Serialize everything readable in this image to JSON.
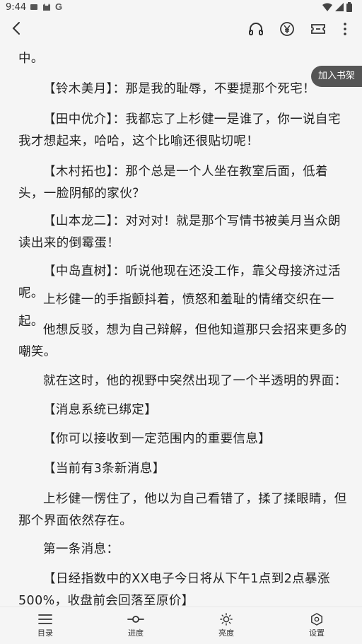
{
  "status_bar": {
    "time": "9:44"
  },
  "book": {
    "add_to_shelf": "加入书架"
  },
  "paragraphs": [
    "中。",
    "【铃木美月】：那是我的耻辱，不要提那个死宅！",
    "【田中优介】：我都忘了上杉健一是谁了，你一说自宅我才想起来，哈哈，这个比喻还很贴切呢！",
    "【木村拓也】：那个总是一个人坐在教室后面，低着头，一脸阴郁的家伙？",
    "【山本龙二】：对对对！就是那个写情书被美月当众朗读出来的倒霉蛋！",
    "【中岛直树】：听说他现在还没工作，靠父母接济过活呢。",
    "上杉健一的手指颤抖着，愤怒和羞耻的情绪交织在一起。",
    "他想反驳，想为自己辩解，但他知道那只会招来更多的嘲笑。",
    "就在这时，他的视野中突然出现了一个半透明的界面：",
    "【消息系统已绑定】",
    "【你可以接收到一定范围内的重要信息】",
    "【当前有3条新消息】",
    "上杉健一愣住了，他以为自己看错了，揉了揉眼睛，但那个界面依然存在。",
    "第一条消息：",
    "【日经指数中的XX电子今日将从下午1点到2点暴涨500%，收盘前会回落至原价】"
  ],
  "bottom_nav": {
    "catalog": "目录",
    "progress": "进度",
    "brightness": "亮度",
    "settings": "设置"
  }
}
